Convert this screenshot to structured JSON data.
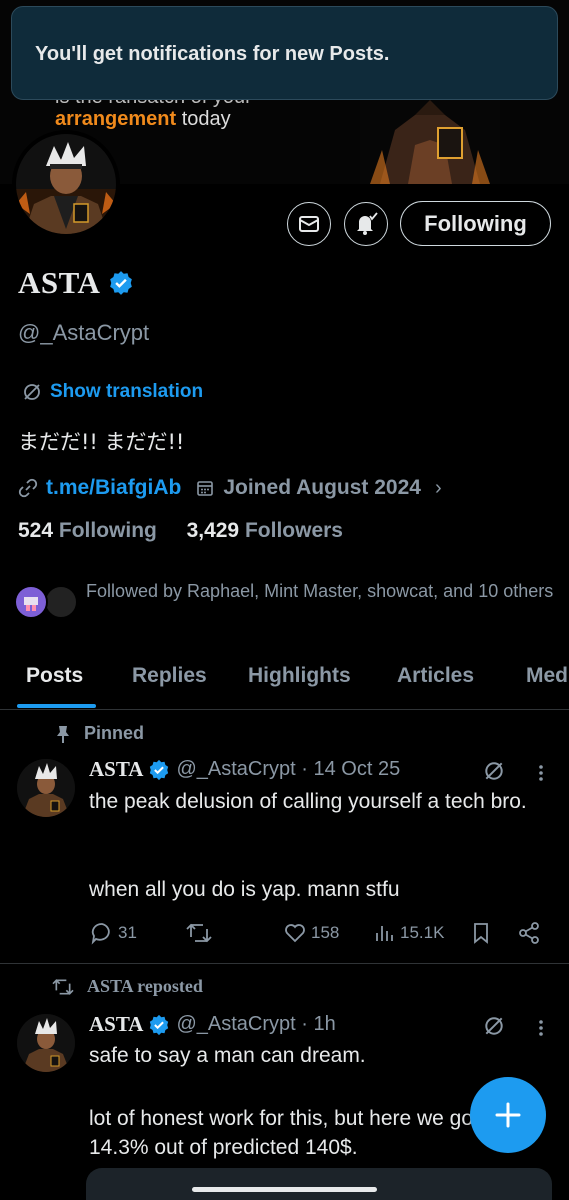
{
  "toast": {
    "text": "You'll get notifications for new Posts."
  },
  "banner": {
    "text_cut": "is the ransatch of your",
    "text_highlight": "arrangement",
    "text_rest": "today"
  },
  "profile": {
    "name": "ASTA",
    "handle": "@_AstaCrypt",
    "follow_button": "Following",
    "show_translation": "Show translation",
    "bio": "まだだ!!  まだだ!!",
    "link": "t.me/BiafgiAb",
    "joined": "Joined August 2024",
    "following_count": "524",
    "following_label": "Following",
    "followers_count": "3,429",
    "followers_label": "Followers",
    "followed_by": "Followed by Raphael, Mint Master, showcat, and 10 others"
  },
  "tabs": [
    {
      "label": "Posts",
      "active": true
    },
    {
      "label": "Replies"
    },
    {
      "label": "Highlights"
    },
    {
      "label": "Articles"
    },
    {
      "label": "Med"
    }
  ],
  "posts": [
    {
      "context": "Pinned",
      "name": "ASTA",
      "handle_time": "@_AstaCrypt · 14 Oct 25",
      "body_1": "the peak delusion of calling yourself a tech bro.",
      "body_2": "when all you do is yap. mann stfu",
      "replies": "31",
      "reposts": "",
      "likes": "158",
      "views": "15.1K"
    },
    {
      "context": "ASTA reposted",
      "name": "ASTA",
      "handle_time": "@_AstaCrypt · 1h",
      "body_1": "safe to say a man can dream.",
      "body_2": "lot of honest work for this, but here we got 14.3% out of predicted 140$."
    }
  ],
  "colors": {
    "accent": "#1d9bf0",
    "muted": "#8b98a5",
    "text": "#e7e9ea",
    "banner_highlight": "#f08a1c"
  },
  "icons": [
    "mail-icon",
    "bell-icon",
    "verified-icon",
    "grok-icon",
    "link-icon",
    "calendar-icon",
    "pin-icon",
    "repost-icon",
    "reply-icon",
    "like-icon",
    "views-icon",
    "bookmark-icon",
    "share-icon",
    "plus-icon"
  ]
}
